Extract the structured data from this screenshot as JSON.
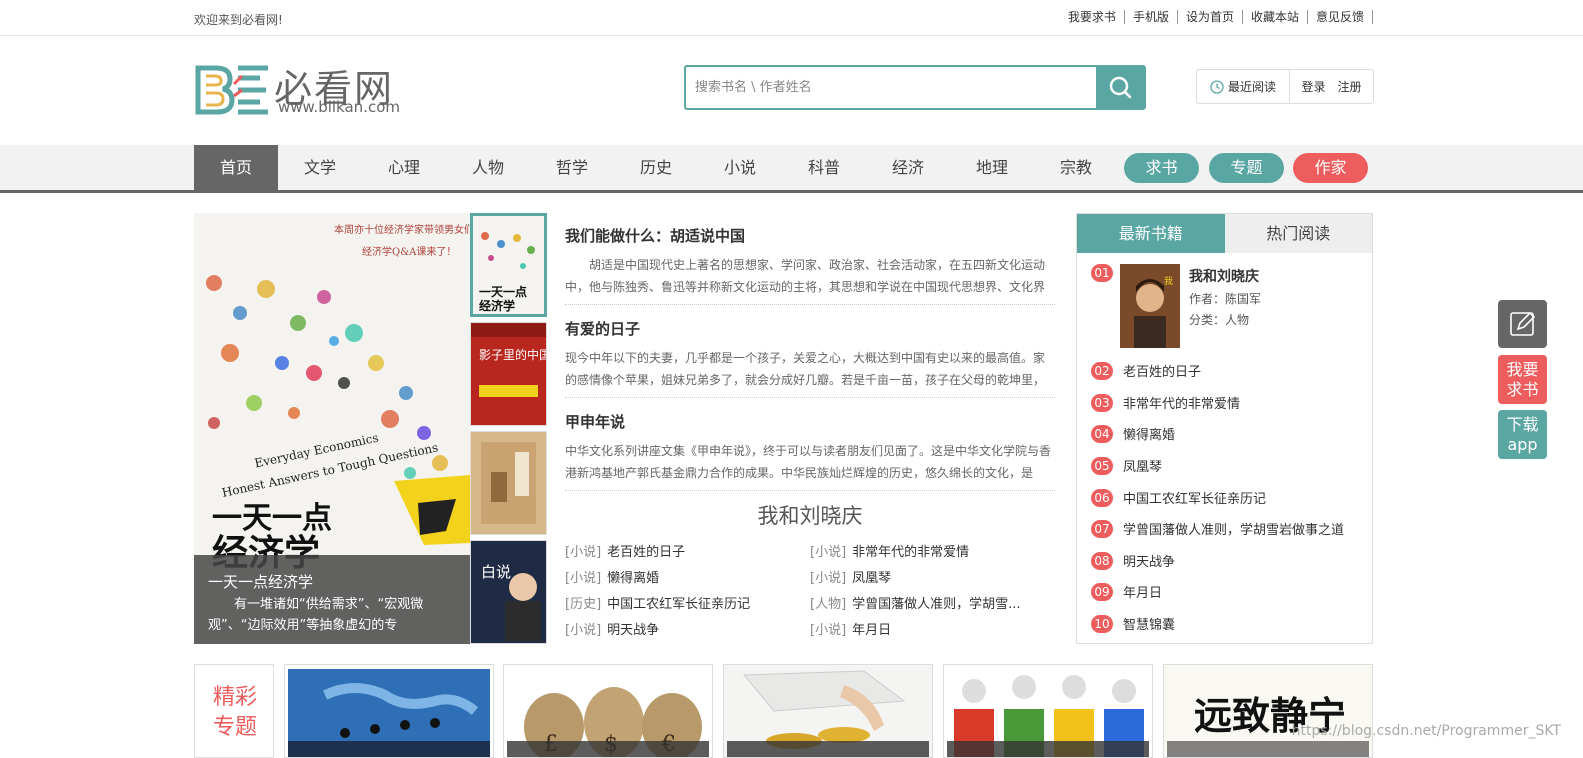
{
  "topbar": {
    "welcome": "欢迎来到必看网!",
    "links": [
      "我要求书",
      "手机版",
      "设为首页",
      "收藏本站",
      "意见反馈"
    ]
  },
  "logo": {
    "name": "必看网",
    "url": "www.biikan.com"
  },
  "search": {
    "placeholder": "搜索书名 \\ 作者姓名"
  },
  "userbox": {
    "recent": "最近阅读",
    "login": "登录",
    "register": "注册"
  },
  "nav": {
    "items": [
      "首页",
      "文学",
      "心理",
      "人物",
      "哲学",
      "历史",
      "小说",
      "科普",
      "经济",
      "地理",
      "宗教"
    ],
    "active": "首页",
    "pills": [
      {
        "label": "求书",
        "color": "#5aa6a3"
      },
      {
        "label": "专题",
        "color": "#5aa6a3"
      },
      {
        "label": "作家",
        "color": "#ee5d5d"
      }
    ]
  },
  "banner": {
    "title": "一天一点经济学",
    "desc": "有一堆诸如“供给需求”、“宏观微观”、“边际效用”等抽象虚幻的专",
    "cover_cn": "一天一点经济学",
    "cover_en1": "Everyday Economics",
    "cover_en2": "Honest Answers to Tough Questions"
  },
  "thumbs": [
    "一天一点经济学",
    "影子里的中国",
    "",
    "白说"
  ],
  "articles": [
    {
      "title": "我们能做什么：胡适说中国",
      "desc": "胡适是中国现代史上著名的思想家、学问家、政治家、社会活动家，在五四新文化运动中，他与陈独秀、鲁迅等并称新文化运动的主将，其思想和学说在中国现代思想界、文化界都"
    },
    {
      "title": "有爱的日子",
      "desc": "现今中年以下的夫妻，几乎都是一个孩子，关爱之心，大概达到中国有史以来的最高值。家的感情像个苹果，姐妹兄弟多了，就会分成好几瓣。若是千亩一苗，孩子在父母的乾坤里，便"
    },
    {
      "title": "甲申年说",
      "desc": "中华文化系列讲座文集《甲申年说》，终于可以与读者朋友们见面了。这是中华文化学院与香港新鸿基地产郭氏基金鼎力合作的成果。中华民族灿烂辉煌的历史，悠久绵长的文化，是"
    }
  ],
  "feature": {
    "title": "我和刘晓庆",
    "items": [
      {
        "cat": "[小说]",
        "name": "老百姓的日子"
      },
      {
        "cat": "[小说]",
        "name": "非常年代的非常爱情"
      },
      {
        "cat": "[小说]",
        "name": "懒得离婚"
      },
      {
        "cat": "[小说]",
        "name": "凤凰琴"
      },
      {
        "cat": "[历史]",
        "name": "中国工农红军长征亲历记"
      },
      {
        "cat": "[人物]",
        "name": "学曾国藩做人准则，学胡雪..."
      },
      {
        "cat": "[小说]",
        "name": "明天战争"
      },
      {
        "cat": "[小说]",
        "name": "年月日"
      }
    ]
  },
  "sidebar": {
    "tabs": [
      "最新书籍",
      "热门阅读"
    ],
    "top": {
      "num": "01",
      "title": "我和刘晓庆",
      "author": "作者：陈国军",
      "category": "分类：人物"
    },
    "ranks": [
      {
        "num": "02",
        "name": "老百姓的日子"
      },
      {
        "num": "03",
        "name": "非常年代的非常爱情"
      },
      {
        "num": "04",
        "name": "懒得离婚"
      },
      {
        "num": "05",
        "name": "凤凰琴"
      },
      {
        "num": "06",
        "name": "中国工农红军长征亲历记"
      },
      {
        "num": "07",
        "name": "学曾国藩做人准则，学胡雪岩做事之道"
      },
      {
        "num": "08",
        "name": "明天战争"
      },
      {
        "num": "09",
        "name": "年月日"
      },
      {
        "num": "10",
        "name": "智慧锦囊"
      }
    ]
  },
  "floats": {
    "request": "我要求书",
    "download": "下载app"
  },
  "bottom": {
    "special": "精彩专题",
    "calligraphy": "远致静宁"
  },
  "watermark": "https://blog.csdn.net/Programmer_SKT",
  "colors": {
    "accent": "#5aa6a3",
    "red": "#ee5d5d",
    "nav_active": "#666666"
  }
}
